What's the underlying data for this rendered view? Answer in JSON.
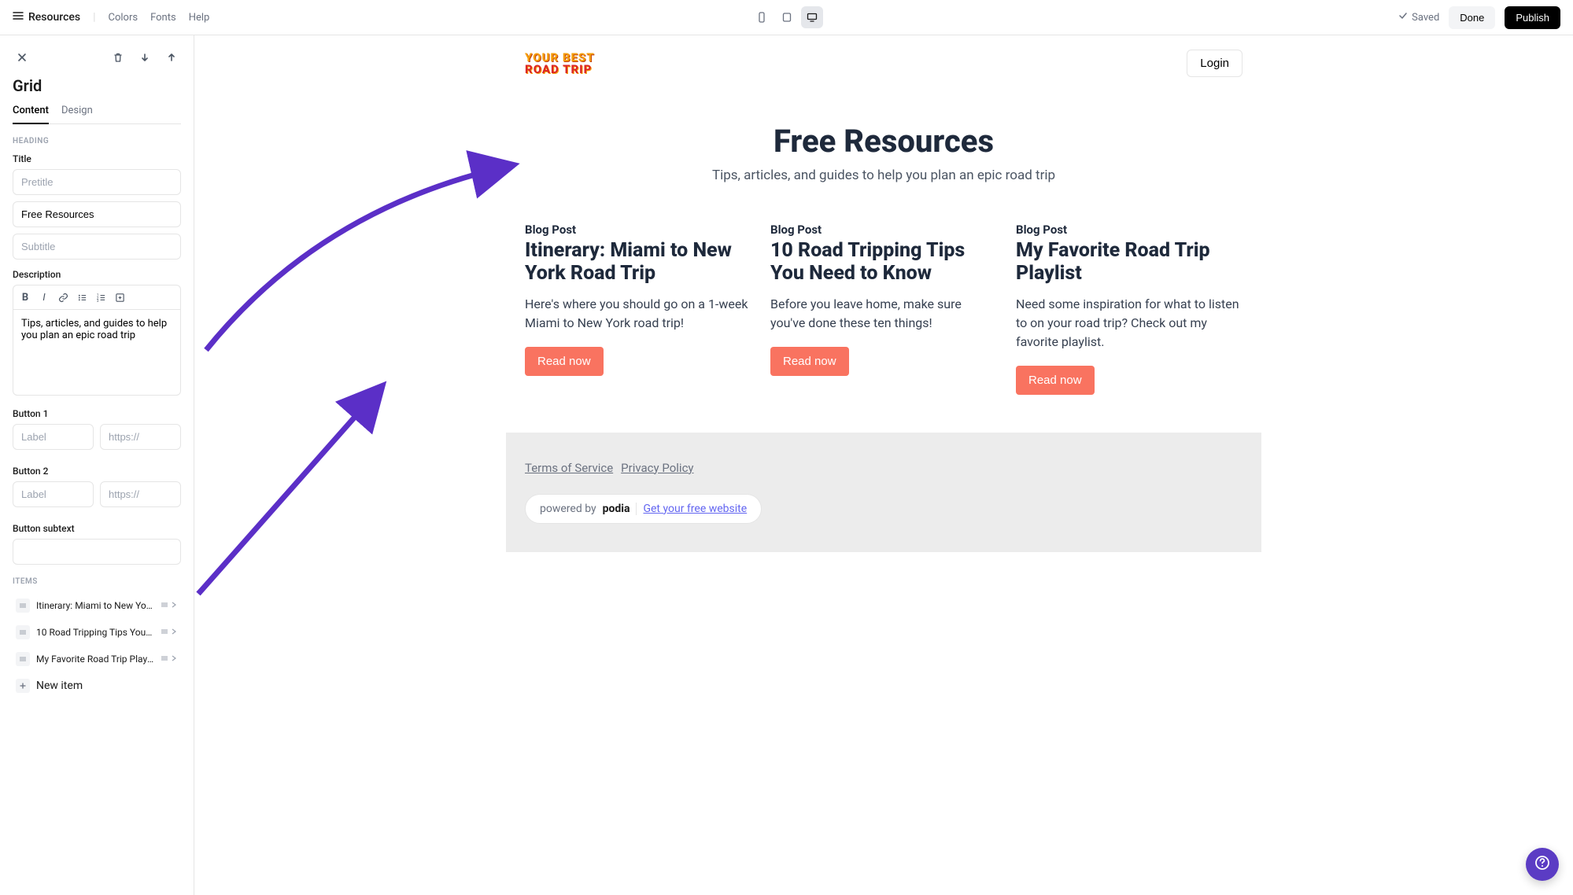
{
  "topbar": {
    "page_name": "Resources",
    "links": {
      "colors": "Colors",
      "fonts": "Fonts",
      "help": "Help"
    },
    "saved": "Saved",
    "done": "Done",
    "publish": "Publish"
  },
  "sidebar": {
    "title": "Grid",
    "tabs": {
      "content": "Content",
      "design": "Design"
    },
    "heading_section": "HEADING",
    "title_label": "Title",
    "pretitle_placeholder": "Pretitle",
    "title_value": "Free Resources",
    "subtitle_placeholder": "Subtitle",
    "description_label": "Description",
    "description_value": "Tips, articles, and guides to help you plan an epic road trip",
    "button1_label": "Button 1",
    "button2_label": "Button 2",
    "label_placeholder": "Label",
    "url_placeholder": "https://",
    "button_subtext_label": "Button subtext",
    "items_section": "ITEMS",
    "items": [
      {
        "label": "Itinerary: Miami to New York…"
      },
      {
        "label": "10 Road Tripping Tips You N…"
      },
      {
        "label": "My Favorite Road Trip Playlist"
      }
    ],
    "new_item": "New item"
  },
  "preview": {
    "logo_line1": "YOUR BEST",
    "logo_line2": "ROAD TRIP",
    "login": "Login",
    "hero_title": "Free Resources",
    "hero_desc": "Tips, articles, and guides to help you plan an epic road trip",
    "cards": [
      {
        "cat": "Blog Post",
        "title": "Itinerary: Miami to New York Road Trip",
        "desc": "Here's where you should go on a 1-week Miami to New York road trip!",
        "btn": "Read now"
      },
      {
        "cat": "Blog Post",
        "title": "10 Road Tripping Tips You Need to Know",
        "desc": "Before you leave home, make sure you've done these ten things!",
        "btn": "Read now"
      },
      {
        "cat": "Blog Post",
        "title": "My Favorite Road Trip Playlist",
        "desc": "Need some inspiration for what to listen to on your road trip? Check out my favorite playlist.",
        "btn": "Read now"
      }
    ],
    "footer": {
      "tos": "Terms of Service",
      "privacy": "Privacy Policy",
      "powered_by": "powered by",
      "brand": "podia",
      "cta": "Get your free website"
    }
  },
  "colors": {
    "accent_arrow": "#5b2fc7",
    "card_btn": "#f97360",
    "publish": "#000000"
  }
}
